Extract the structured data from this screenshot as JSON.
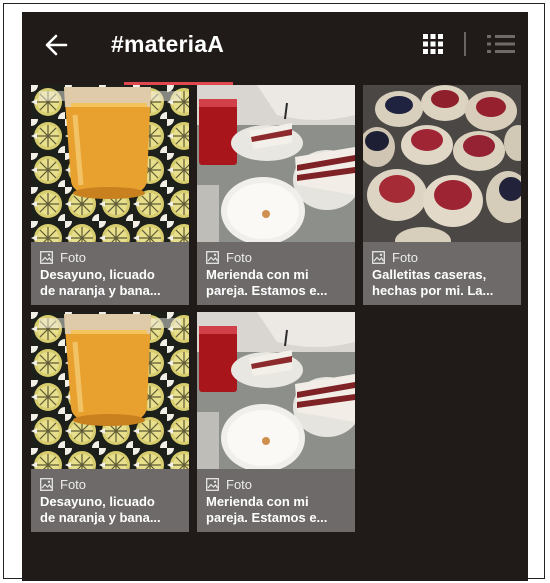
{
  "header": {
    "title": "#materiaA"
  },
  "posts": [
    {
      "type_label": "Foto",
      "caption_line1": "Desayuno, licuado",
      "caption_line2": "de naranja y bana...",
      "image": "orange-juice-photo"
    },
    {
      "type_label": "Foto",
      "caption_line1": "Merienda con mi",
      "caption_line2": "pareja. Estamos e...",
      "image": "cake-and-drinks-photo"
    },
    {
      "type_label": "Foto",
      "caption_line1": "Galletitas caseras,",
      "caption_line2": "hechas por mi. La...",
      "image": "jam-cookies-photo"
    },
    {
      "type_label": "Foto",
      "caption_line1": "Desayuno, licuado",
      "caption_line2": "de naranja y bana...",
      "image": "orange-juice-photo"
    },
    {
      "type_label": "Foto",
      "caption_line1": "Merienda con mi",
      "caption_line2": "pareja. Estamos e...",
      "image": "cake-and-drinks-photo"
    }
  ],
  "colors": {
    "background": "#201b19",
    "tab_underline": "#e0484f",
    "card_meta": "#6d6a69"
  }
}
